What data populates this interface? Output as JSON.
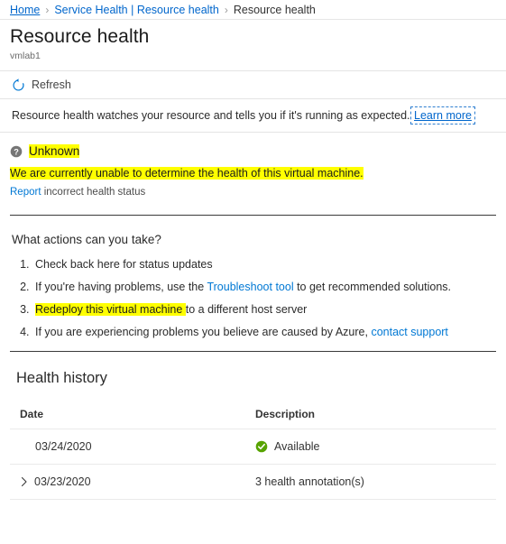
{
  "breadcrumb": {
    "home": "Home",
    "service_health": "Service Health | Resource health",
    "current": "Resource health",
    "separator": "›"
  },
  "header": {
    "title": "Resource health",
    "subtitle": "vmlab1"
  },
  "commandbar": {
    "refresh_label": "Refresh",
    "refresh_icon": "refresh-icon"
  },
  "description": {
    "text": "Resource health watches your resource and tells you if it's running as expected.",
    "learn_more": "Learn more"
  },
  "status": {
    "icon": "question-circle-icon",
    "title": "Unknown",
    "message": "We are currently unable to determine the health of this virtual machine.",
    "report_link": "Report",
    "report_rest": "incorrect health status"
  },
  "actions": {
    "heading": "What actions can you take?",
    "items": [
      {
        "pre": "Check back here for status updates",
        "link": "",
        "post": ""
      },
      {
        "pre": "If you're having problems, use the ",
        "link": "Troubleshoot tool",
        "post": " to get recommended solutions."
      },
      {
        "pre": "",
        "link": "",
        "highlight": "Redeploy this virtual machine ",
        "post": "to a different host server"
      },
      {
        "pre": "If you are experiencing problems you believe are caused by Azure, ",
        "link": "contact support",
        "post": ""
      }
    ]
  },
  "health_history": {
    "title": "Health history",
    "columns": {
      "date": "Date",
      "description": "Description"
    },
    "rows": [
      {
        "date": "03/24/2020",
        "description": "Available",
        "icon": "check-circle-icon",
        "expandable": false
      },
      {
        "date": "03/23/2020",
        "description": "3 health annotation(s)",
        "icon": "",
        "expandable": true
      }
    ]
  },
  "colors": {
    "link": "#0078d4",
    "breadcrumb_link": "#0066cc",
    "highlight": "#ffff00",
    "available_green": "#57a300",
    "unknown_gray": "#767676"
  }
}
